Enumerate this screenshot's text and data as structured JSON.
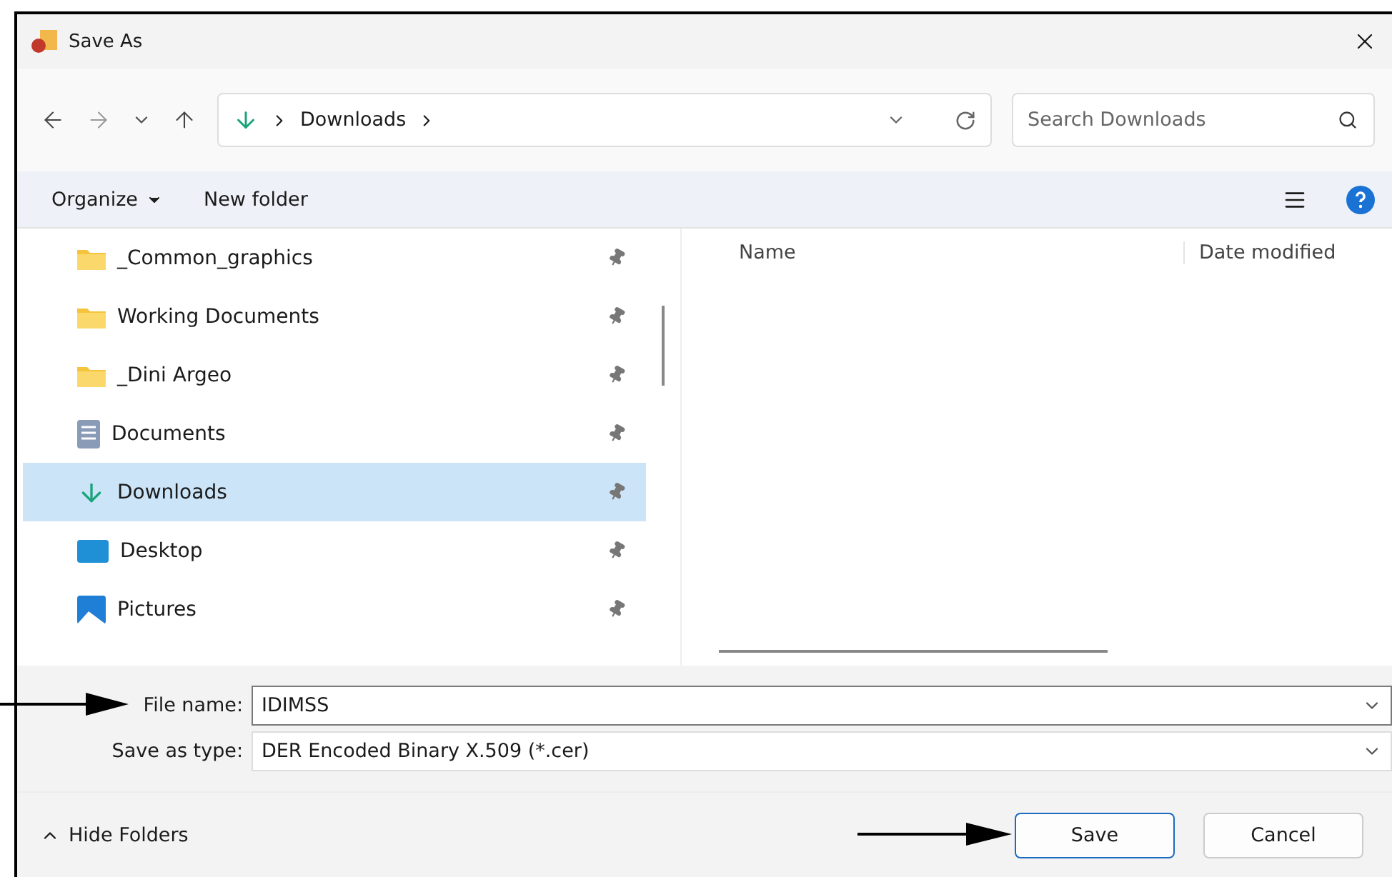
{
  "window": {
    "title": "Save As"
  },
  "nav": {
    "path": [
      "Downloads"
    ],
    "search": {
      "placeholder": "Search Downloads"
    }
  },
  "toolbar": {
    "organize": "Organize",
    "new_folder": "New folder"
  },
  "sidebar": {
    "items": [
      {
        "label": "_Common_graphics",
        "kind": "folder",
        "selected": false,
        "pinned": true
      },
      {
        "label": "Working Documents",
        "kind": "folder",
        "selected": false,
        "pinned": true
      },
      {
        "label": "_Dini Argeo",
        "kind": "folder",
        "selected": false,
        "pinned": true
      },
      {
        "label": "Documents",
        "kind": "documents",
        "selected": false,
        "pinned": true
      },
      {
        "label": "Downloads",
        "kind": "downloads",
        "selected": true,
        "pinned": true
      },
      {
        "label": "Desktop",
        "kind": "desktop",
        "selected": false,
        "pinned": true
      },
      {
        "label": "Pictures",
        "kind": "pictures",
        "selected": false,
        "pinned": true
      }
    ]
  },
  "columns": [
    "Name",
    "Date modified"
  ],
  "fields": [
    {
      "label": "File name:",
      "value": "IDIMSS",
      "kind": "edit"
    },
    {
      "label": "Save as type:",
      "value": "DER Encoded Binary X.509 (*.cer)",
      "kind": "select"
    }
  ],
  "footer": {
    "toggle": "Hide Folders",
    "buttons": [
      {
        "label": "Save",
        "default": true
      },
      {
        "label": "Cancel",
        "default": false
      }
    ]
  }
}
